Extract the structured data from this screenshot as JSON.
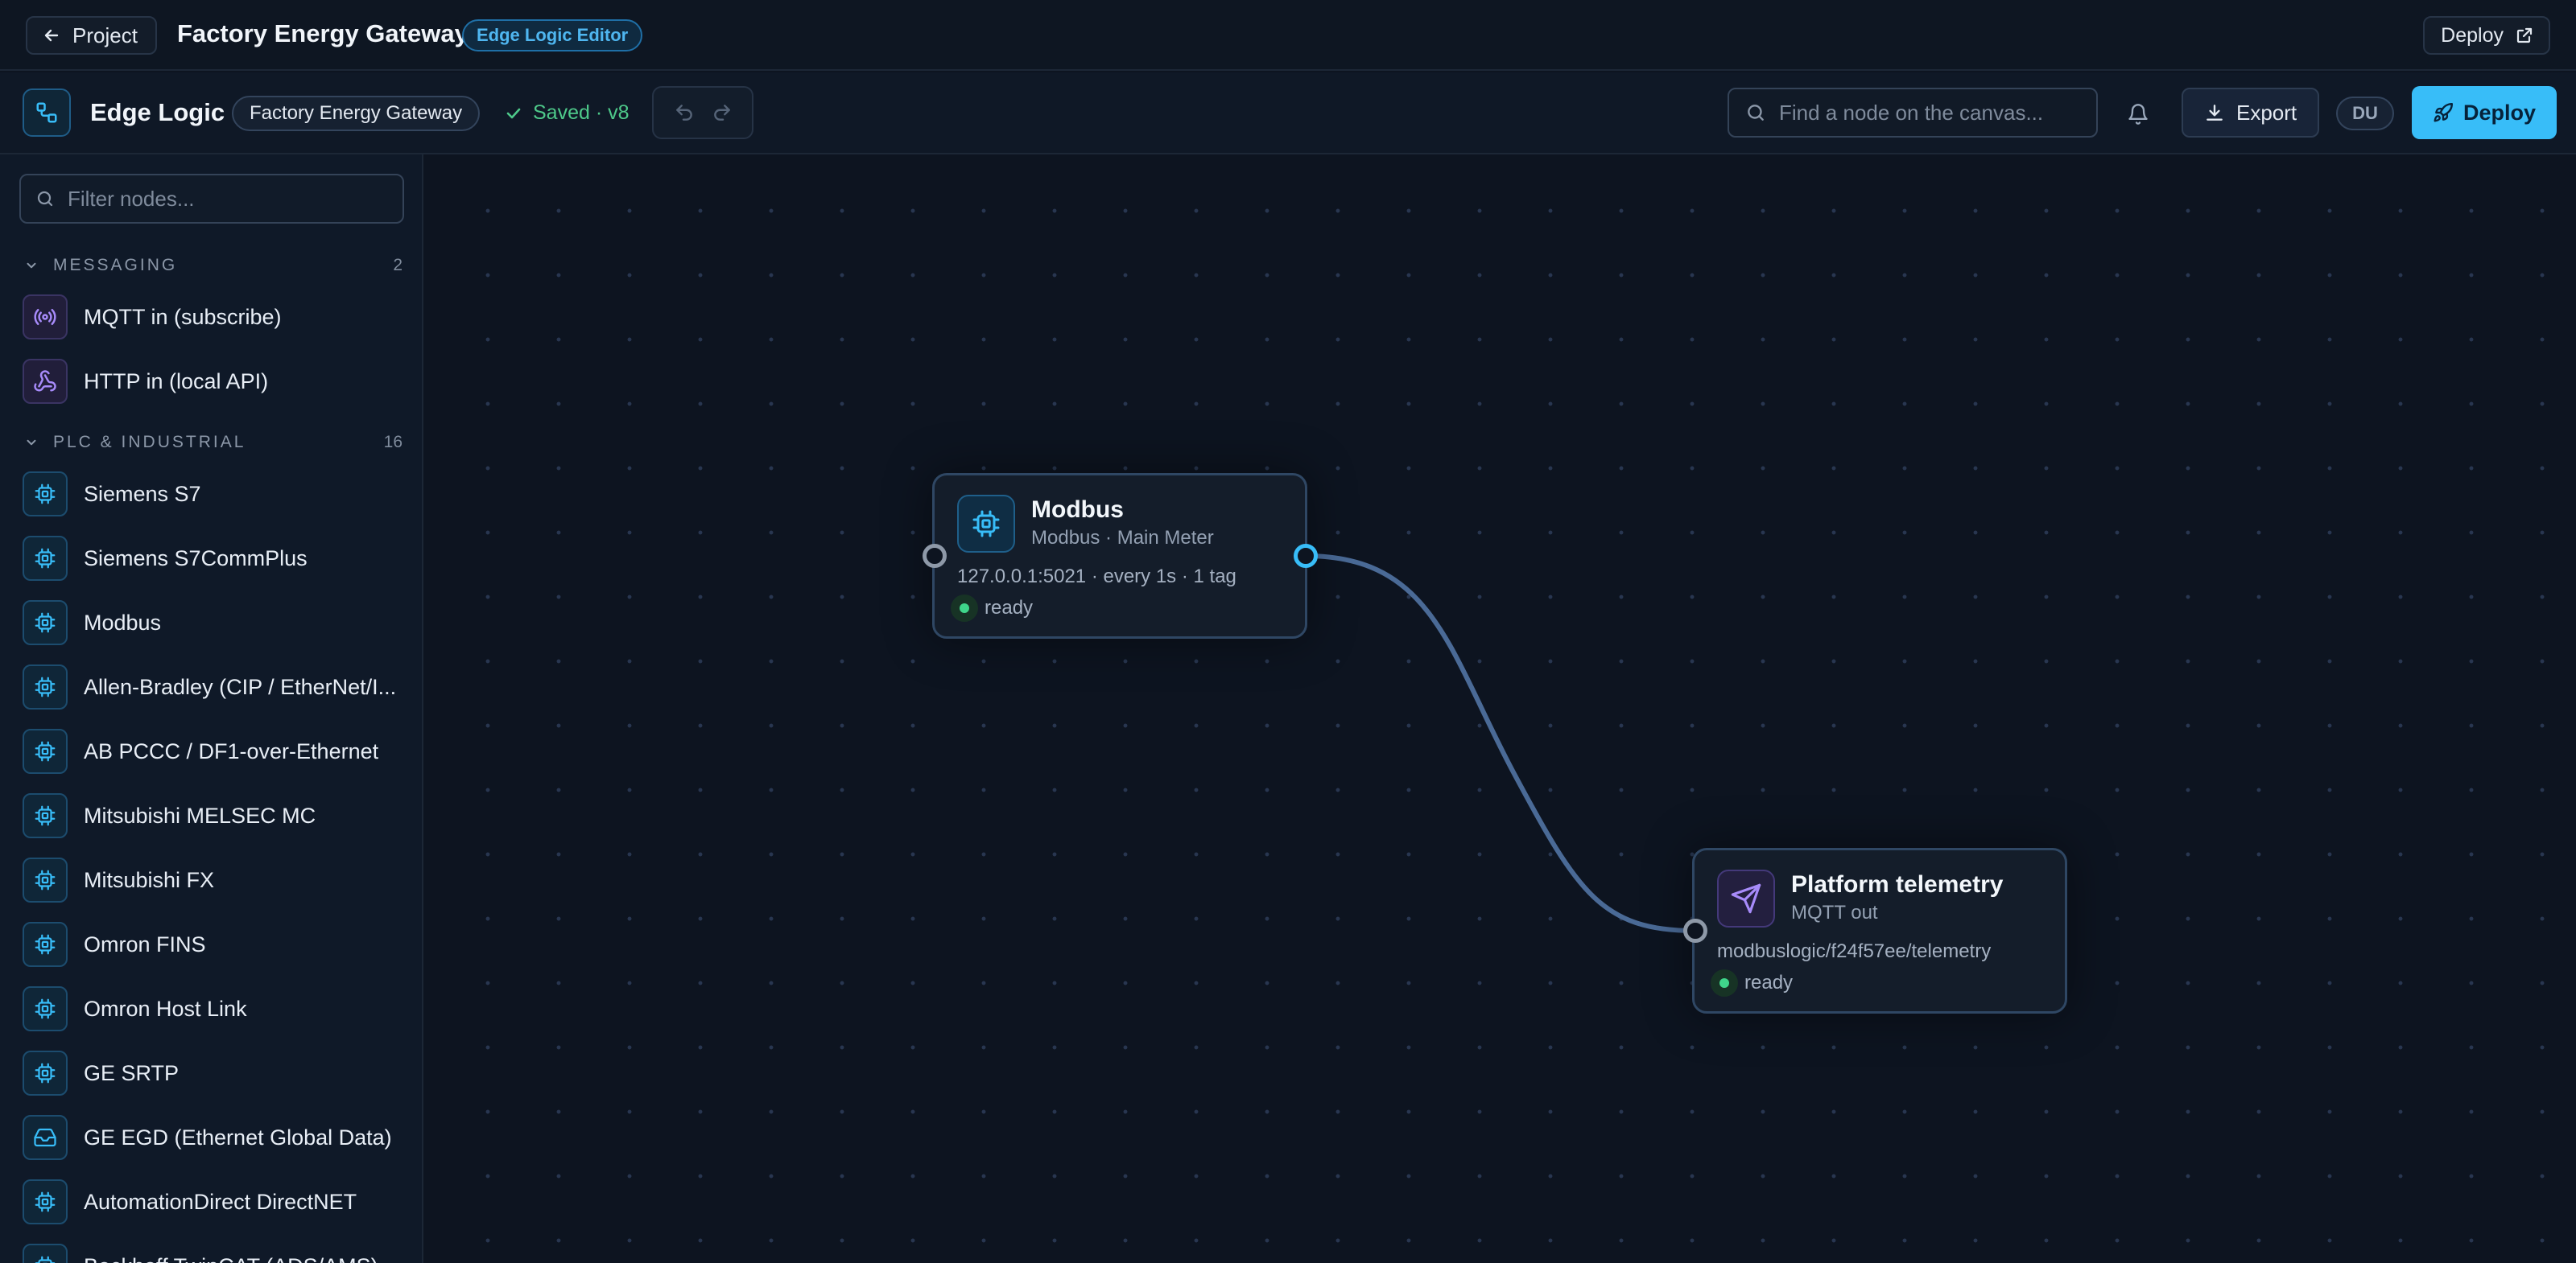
{
  "header": {
    "back_label": "Project",
    "title": "Factory Energy Gateway",
    "badge": "Edge Logic Editor",
    "deploy_label": "Deploy"
  },
  "toolbar": {
    "title": "Edge Logic",
    "project_pill": "Factory Energy Gateway",
    "saved_label": "Saved · v8",
    "search_placeholder": "Find a node on the canvas...",
    "export_label": "Export",
    "avatar_initials": "DU",
    "deploy_label": "Deploy"
  },
  "sidebar": {
    "filter_placeholder": "Filter nodes...",
    "categories": [
      {
        "name": "MESSAGING",
        "count": "2",
        "items": [
          {
            "label": "MQTT in (subscribe)",
            "icon": "broadcast-icon"
          },
          {
            "label": "HTTP in (local API)",
            "icon": "webhook-icon"
          }
        ]
      },
      {
        "name": "PLC & INDUSTRIAL",
        "count": "16",
        "items": [
          {
            "label": "Siemens S7",
            "icon": "chip-icon"
          },
          {
            "label": "Siemens S7CommPlus",
            "icon": "chip-icon"
          },
          {
            "label": "Modbus",
            "icon": "chip-icon"
          },
          {
            "label": "Allen-Bradley (CIP / EtherNet/I...",
            "icon": "chip-icon"
          },
          {
            "label": "AB PCCC / DF1-over-Ethernet",
            "icon": "chip-icon"
          },
          {
            "label": "Mitsubishi MELSEC MC",
            "icon": "chip-icon"
          },
          {
            "label": "Mitsubishi FX",
            "icon": "chip-icon"
          },
          {
            "label": "Omron FINS",
            "icon": "chip-icon"
          },
          {
            "label": "Omron Host Link",
            "icon": "chip-icon"
          },
          {
            "label": "GE SRTP",
            "icon": "chip-icon"
          },
          {
            "label": "GE EGD (Ethernet Global Data)",
            "icon": "inbox-icon"
          },
          {
            "label": "AutomationDirect DirectNET",
            "icon": "chip-icon"
          },
          {
            "label": "Beckhoff TwinCAT (ADS/AMS)",
            "icon": "chip-icon"
          }
        ]
      }
    ]
  },
  "canvas": {
    "nodes": [
      {
        "title": "Modbus",
        "subtitle": "Modbus · Main Meter",
        "detail": "127.0.0.1:5021 · every 1s · 1 tag",
        "status": "ready",
        "icon": "chip-icon"
      },
      {
        "title": "Platform telemetry",
        "subtitle": "MQTT out",
        "detail": "modbuslogic/f24f57ee/telemetry",
        "status": "ready",
        "icon": "send-icon"
      }
    ]
  },
  "colors": {
    "accent": "#38bdf8",
    "background": "#0d1420",
    "status_ok": "#3fd68a",
    "wire": "#4a6a96"
  }
}
